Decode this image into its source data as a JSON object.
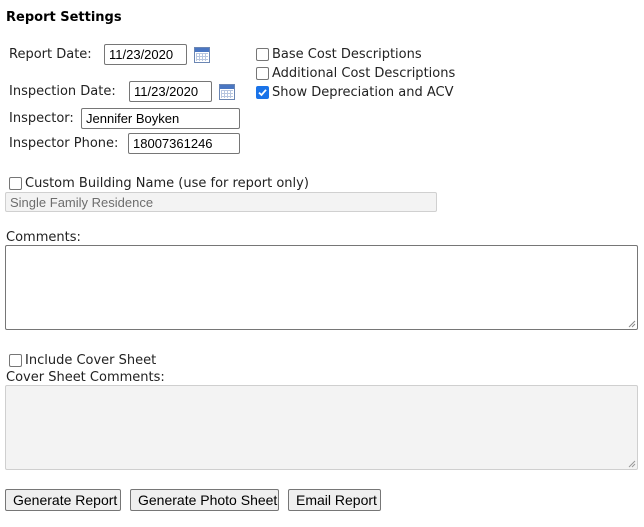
{
  "title": "Report Settings",
  "report_date": {
    "label": "Report Date:",
    "value": "11/23/2020"
  },
  "inspection_date": {
    "label": "Inspection Date:",
    "value": "11/23/2020"
  },
  "inspector": {
    "label": "Inspector:",
    "value": "Jennifer Boyken"
  },
  "inspector_phone": {
    "label": "Inspector Phone:",
    "value": "18007361246"
  },
  "options": [
    {
      "label": "Base Cost Descriptions",
      "checked": false
    },
    {
      "label": "Additional Cost Descriptions",
      "checked": false
    },
    {
      "label": "Show Depreciation and ACV",
      "checked": true
    }
  ],
  "custom_building": {
    "label": "Custom Building Name (use for report only)",
    "checked": false,
    "value": "Single Family Residence"
  },
  "comments": {
    "label": "Comments:",
    "value": ""
  },
  "cover_sheet": {
    "label": "Include Cover Sheet",
    "checked": false
  },
  "cover_comments": {
    "label": "Cover Sheet Comments:",
    "value": ""
  },
  "buttons": {
    "generate_report": "Generate Report",
    "generate_photo_sheet": "Generate Photo Sheet",
    "email_report": "Email Report"
  },
  "icons": {
    "calendar": "calendar-icon",
    "checkmark": "checkmark-icon",
    "resize": "resize-grip-icon"
  },
  "colors": {
    "checkbox_checked": "#1a73e8",
    "calendar_blue": "#4a76c2"
  }
}
